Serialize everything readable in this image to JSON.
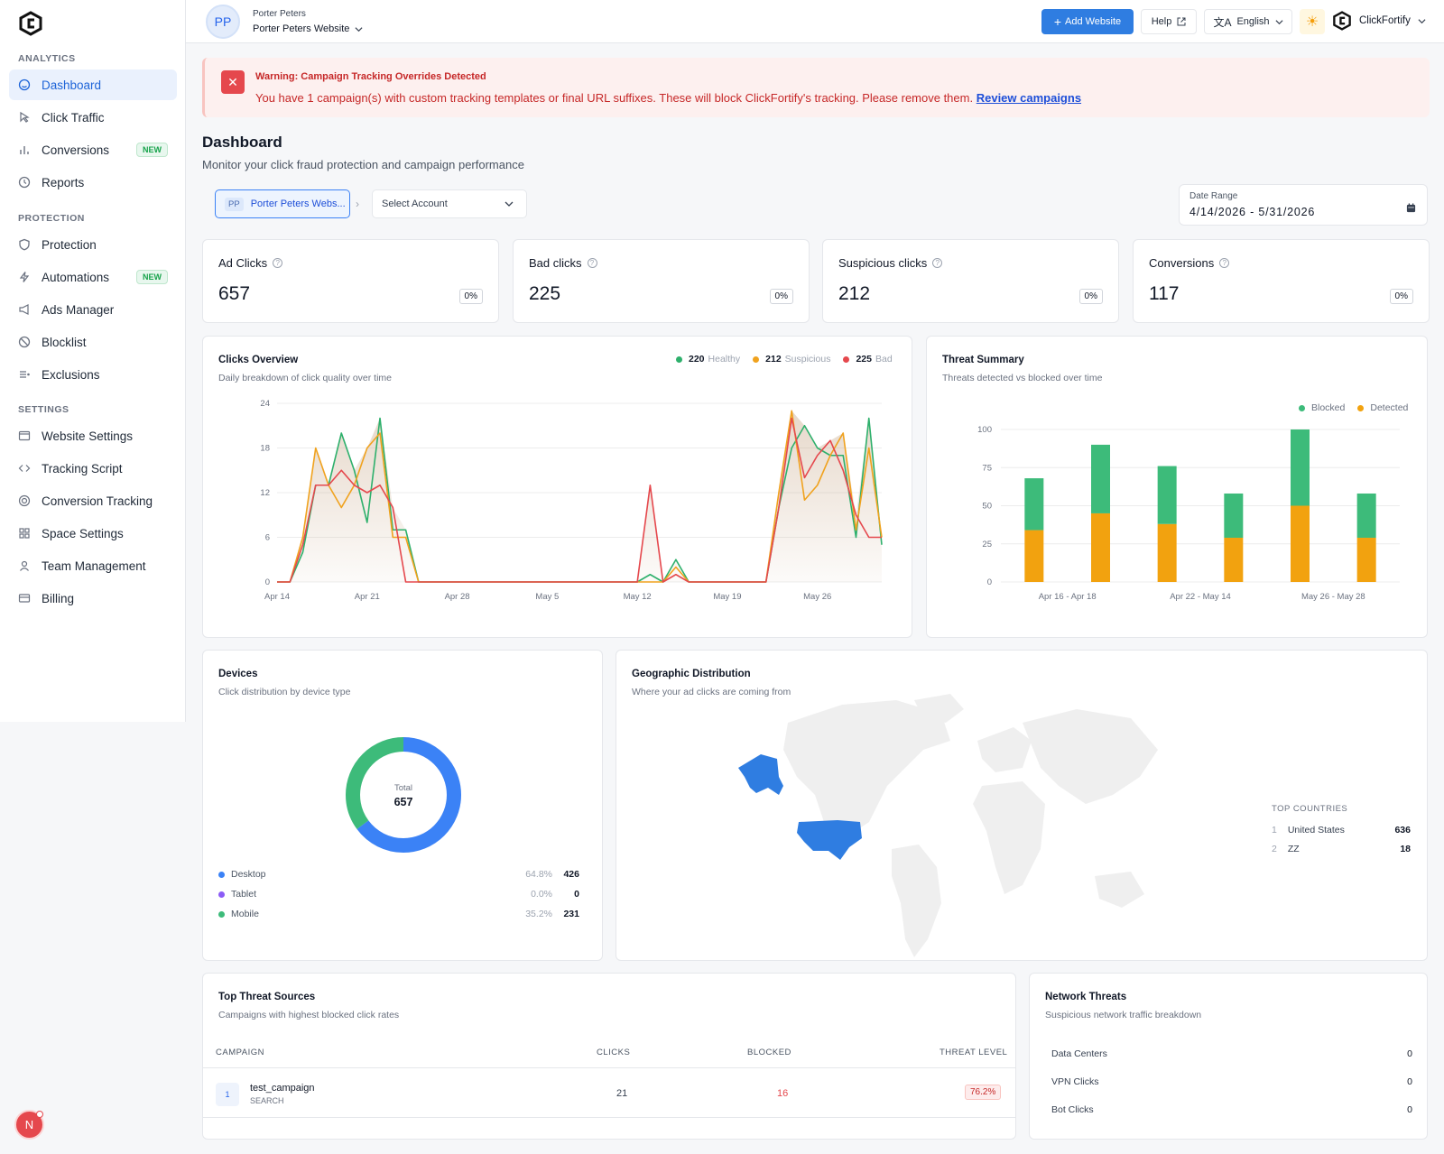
{
  "sidebar": {
    "sections": {
      "analytics": "ANALYTICS",
      "protection": "PROTECTION",
      "settings": "SETTINGS"
    },
    "items": [
      {
        "label": "Dashboard",
        "icon": "home-icon",
        "active": true
      },
      {
        "label": "Click Traffic",
        "icon": "cursor-icon"
      },
      {
        "label": "Conversions",
        "icon": "bar-chart-icon",
        "badge": "NEW"
      },
      {
        "label": "Reports",
        "icon": "clock-icon"
      },
      {
        "label": "Protection",
        "icon": "shield-icon"
      },
      {
        "label": "Automations",
        "icon": "bolt-icon",
        "badge": "NEW"
      },
      {
        "label": "Ads Manager",
        "icon": "megaphone-icon"
      },
      {
        "label": "Blocklist",
        "icon": "ban-icon"
      },
      {
        "label": "Exclusions",
        "icon": "list-icon"
      },
      {
        "label": "Website Settings",
        "icon": "browser-icon"
      },
      {
        "label": "Tracking Script",
        "icon": "code-icon"
      },
      {
        "label": "Conversion Tracking",
        "icon": "target-icon"
      },
      {
        "label": "Space Settings",
        "icon": "grid-icon"
      },
      {
        "label": "Team Management",
        "icon": "users-icon"
      },
      {
        "label": "Billing",
        "icon": "card-icon"
      }
    ]
  },
  "topbar": {
    "avatar_initials": "PP",
    "account_name": "Porter Peters",
    "website_name": "Porter Peters Website",
    "add_website": "Add Website",
    "help": "Help",
    "language": "English",
    "brand": "ClickFortify"
  },
  "alert": {
    "title": "Warning: Campaign Tracking Overrides Detected",
    "message": "You have 1 campaign(s) with custom tracking templates or final URL suffixes. These will block ClickFortify's tracking. Please remove them.",
    "link": "Review campaigns"
  },
  "page": {
    "title": "Dashboard",
    "subtitle": "Monitor your click fraud protection and campaign performance",
    "site_chip_initials": "PP",
    "site_chip_label": "Porter Peters Webs...",
    "select_account": "Select Account",
    "date_range_label": "Date Range",
    "date_range_value": "4/14/2026 - 5/31/2026"
  },
  "stats": [
    {
      "label": "Ad Clicks",
      "value": "657",
      "pct": "0%"
    },
    {
      "label": "Bad clicks",
      "value": "225",
      "pct": "0%"
    },
    {
      "label": "Suspicious clicks",
      "value": "212",
      "pct": "0%"
    },
    {
      "label": "Conversions",
      "value": "117",
      "pct": "0%"
    }
  ],
  "clicks_overview": {
    "title": "Clicks Overview",
    "subtitle": "Daily breakdown of click quality over time",
    "legend": [
      {
        "count": "220",
        "label": "Healthy",
        "color": "#2eb06c"
      },
      {
        "count": "212",
        "label": "Suspicious",
        "color": "#f0a21e"
      },
      {
        "count": "225",
        "label": "Bad",
        "color": "#e5484d"
      }
    ]
  },
  "threat_summary": {
    "title": "Threat Summary",
    "subtitle": "Threats detected vs blocked over time",
    "legend": [
      {
        "label": "Blocked",
        "color": "#3dbb7a"
      },
      {
        "label": "Detected",
        "color": "#f2a20f"
      }
    ]
  },
  "devices": {
    "title": "Devices",
    "subtitle": "Click distribution by device type",
    "total_label": "Total",
    "total_value": "657",
    "rows": [
      {
        "label": "Desktop",
        "pct": "64.8%",
        "count": "426",
        "color": "#3b82f6"
      },
      {
        "label": "Tablet",
        "pct": "0.0%",
        "count": "0",
        "color": "#8b5cf6"
      },
      {
        "label": "Mobile",
        "pct": "35.2%",
        "count": "231",
        "color": "#3dbb7a"
      }
    ]
  },
  "geo": {
    "title": "Geographic Distribution",
    "subtitle": "Where your ad clicks are coming from",
    "top_label": "TOP COUNTRIES",
    "countries": [
      {
        "rank": "1",
        "name": "United States",
        "count": "636"
      },
      {
        "rank": "2",
        "name": "ZZ",
        "count": "18"
      }
    ]
  },
  "threat_sources": {
    "title": "Top Threat Sources",
    "subtitle": "Campaigns with highest blocked click rates",
    "headers": {
      "campaign": "CAMPAIGN",
      "clicks": "CLICKS",
      "blocked": "BLOCKED",
      "threat": "THREAT LEVEL"
    },
    "rows": [
      {
        "rank": "1",
        "name": "test_campaign",
        "type": "SEARCH",
        "clicks": "21",
        "blocked": "16",
        "threat": "76.2%"
      }
    ]
  },
  "network": {
    "title": "Network Threats",
    "subtitle": "Suspicious network traffic breakdown",
    "rows": [
      {
        "label": "Data Centers",
        "value": "0"
      },
      {
        "label": "VPN Clicks",
        "value": "0"
      },
      {
        "label": "Bot Clicks",
        "value": "0"
      }
    ]
  },
  "fab_initial": "N",
  "chart_data": [
    {
      "type": "line",
      "title": "Clicks Overview",
      "x_ticks": [
        "Apr 14",
        "Apr 21",
        "Apr 28",
        "May 5",
        "May 12",
        "May 19",
        "May 26"
      ],
      "x": [
        "Apr 14",
        "Apr 15",
        "Apr 16",
        "Apr 17",
        "Apr 18",
        "Apr 19",
        "Apr 20",
        "Apr 21",
        "Apr 22",
        "Apr 23",
        "Apr 24",
        "Apr 25",
        "Apr 26",
        "Apr 27",
        "Apr 28",
        "Apr 29",
        "Apr 30",
        "May 1",
        "May 2",
        "May 3",
        "May 4",
        "May 5",
        "May 6",
        "May 7",
        "May 8",
        "May 9",
        "May 10",
        "May 11",
        "May 12",
        "May 13",
        "May 14",
        "May 15",
        "May 16",
        "May 17",
        "May 18",
        "May 19",
        "May 20",
        "May 21",
        "May 22",
        "May 23",
        "May 24",
        "May 25",
        "May 26",
        "May 27",
        "May 28",
        "May 29",
        "May 30",
        "May 31"
      ],
      "series": [
        {
          "name": "Healthy",
          "color": "#2eb06c",
          "values": [
            0,
            0,
            4,
            13,
            13,
            20,
            15,
            8,
            22,
            7,
            7,
            0,
            0,
            0,
            0,
            0,
            0,
            0,
            0,
            0,
            0,
            0,
            0,
            0,
            0,
            0,
            0,
            0,
            0,
            1,
            0,
            3,
            0,
            0,
            0,
            0,
            0,
            0,
            0,
            10,
            18,
            21,
            18,
            17,
            17,
            6,
            22,
            5
          ]
        },
        {
          "name": "Suspicious",
          "color": "#f0a21e",
          "values": [
            0,
            0,
            6,
            18,
            13,
            10,
            13,
            18,
            20,
            6,
            6,
            0,
            0,
            0,
            0,
            0,
            0,
            0,
            0,
            0,
            0,
            0,
            0,
            0,
            0,
            0,
            0,
            0,
            0,
            0,
            0,
            2,
            0,
            0,
            0,
            0,
            0,
            0,
            0,
            12,
            23,
            11,
            13,
            17,
            20,
            7,
            18,
            6
          ]
        },
        {
          "name": "Bad",
          "color": "#e5484d",
          "values": [
            0,
            0,
            5,
            13,
            13,
            15,
            13,
            12,
            13,
            10,
            0,
            0,
            0,
            0,
            0,
            0,
            0,
            0,
            0,
            0,
            0,
            0,
            0,
            0,
            0,
            0,
            0,
            0,
            0,
            13,
            0,
            1,
            0,
            0,
            0,
            0,
            0,
            0,
            0,
            10,
            22,
            14,
            17,
            19,
            15,
            9,
            6,
            6
          ]
        }
      ],
      "ylim": [
        0,
        24
      ],
      "y_ticks": [
        0,
        6,
        12,
        18,
        24
      ],
      "grid": true,
      "legend": "top-right"
    },
    {
      "type": "bar",
      "stacked": true,
      "title": "Threat Summary",
      "categories": [
        "Apr 16 - Apr 18",
        "",
        "Apr 22 - May 14",
        "",
        "May 26 - May 28",
        ""
      ],
      "series": [
        {
          "name": "Detected",
          "color": "#f2a20f",
          "values": [
            34,
            45,
            38,
            29,
            50,
            29
          ]
        },
        {
          "name": "Blocked",
          "color": "#3dbb7a",
          "values": [
            34,
            45,
            38,
            29,
            50,
            29
          ]
        }
      ],
      "ylim": [
        0,
        100
      ],
      "y_ticks": [
        0,
        25,
        50,
        75,
        100
      ],
      "grid": true,
      "legend": "top-right"
    },
    {
      "type": "pie",
      "donut": true,
      "title": "Devices",
      "categories": [
        "Desktop",
        "Tablet",
        "Mobile"
      ],
      "values": [
        426,
        0,
        231
      ]
    }
  ]
}
